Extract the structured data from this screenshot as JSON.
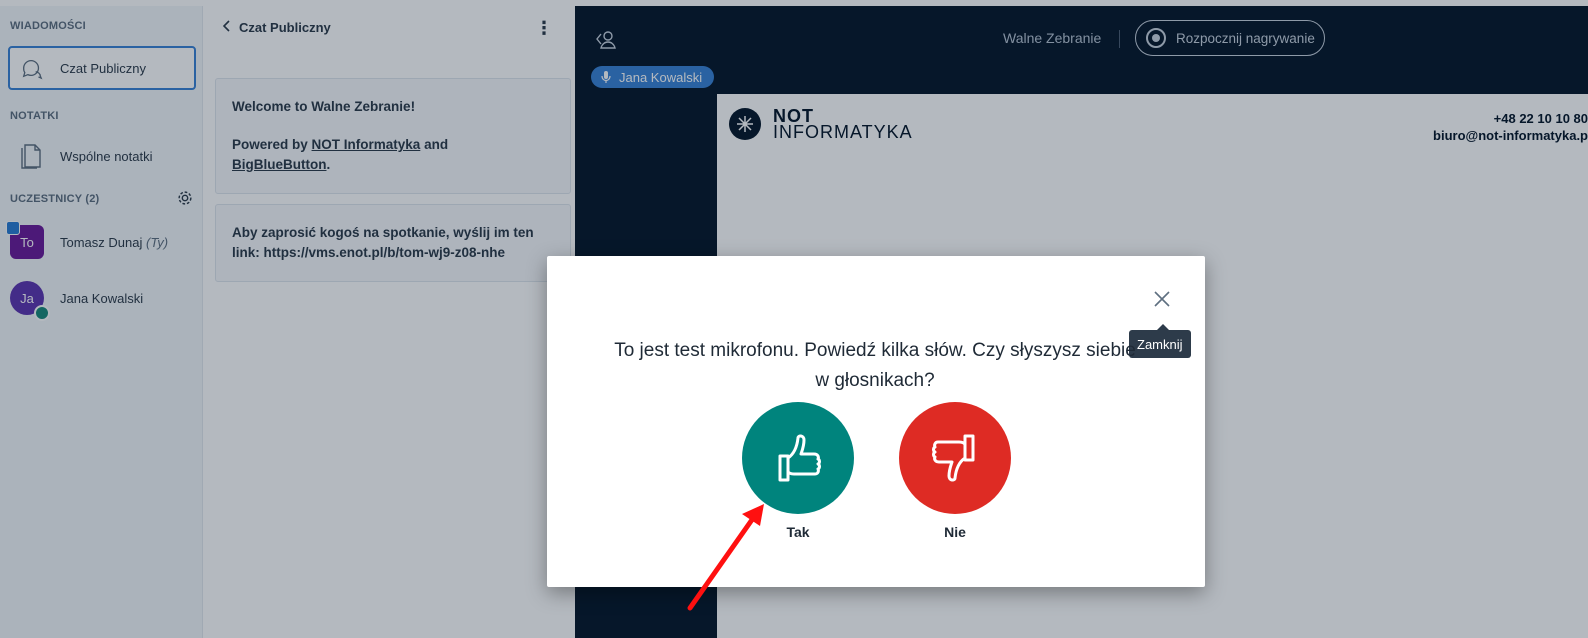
{
  "sidebar": {
    "messages_title": "WIADOMOŚCI",
    "public_chat": "Czat Publiczny",
    "notes_title": "NOTATKI",
    "shared_notes": "Wspólne notatki",
    "participants_title": "UCZESTNICY (2)",
    "users": [
      {
        "initials": "To",
        "name": "Tomasz Dunaj",
        "suffix": "(Ty)"
      },
      {
        "initials": "Ja",
        "name": "Jana Kowalski"
      }
    ]
  },
  "chat": {
    "header": "Czat Publiczny",
    "welcome_prefix": "Welcome to ",
    "welcome_name": "Walne Zebranie",
    "welcome_suffix": "!",
    "powered_by": "Powered by ",
    "link1": "NOT Informatyka",
    "and": " and",
    "link2": "BigBlueButton",
    "period": ".",
    "invite": "Aby zaprosić kogoś na spotkanie, wyślij im ten link: https://vms.enot.pl/b/tom-wj9-z08-nhe"
  },
  "header": {
    "meeting_title": "Walne Zebranie",
    "record_label": "Rozpocznij nagrywanie",
    "talking_user": "Jana Kowalski"
  },
  "slide": {
    "brand_top": "NOT",
    "brand_bottom": "INFORMATYKA",
    "phone": "+48 22 10 10 80",
    "email": "biuro@not-informatyka.p"
  },
  "modal": {
    "question": "To jest test mikrofonu. Powiedź kilka słów. Czy słyszysz siebie w głosnikach?",
    "close_tooltip": "Zamknij",
    "yes_label": "Tak",
    "no_label": "Nie"
  },
  "colors": {
    "yes": "#00847d",
    "no": "#de2b24",
    "dark_bg": "#06172a",
    "accent": "#3a83d6"
  }
}
